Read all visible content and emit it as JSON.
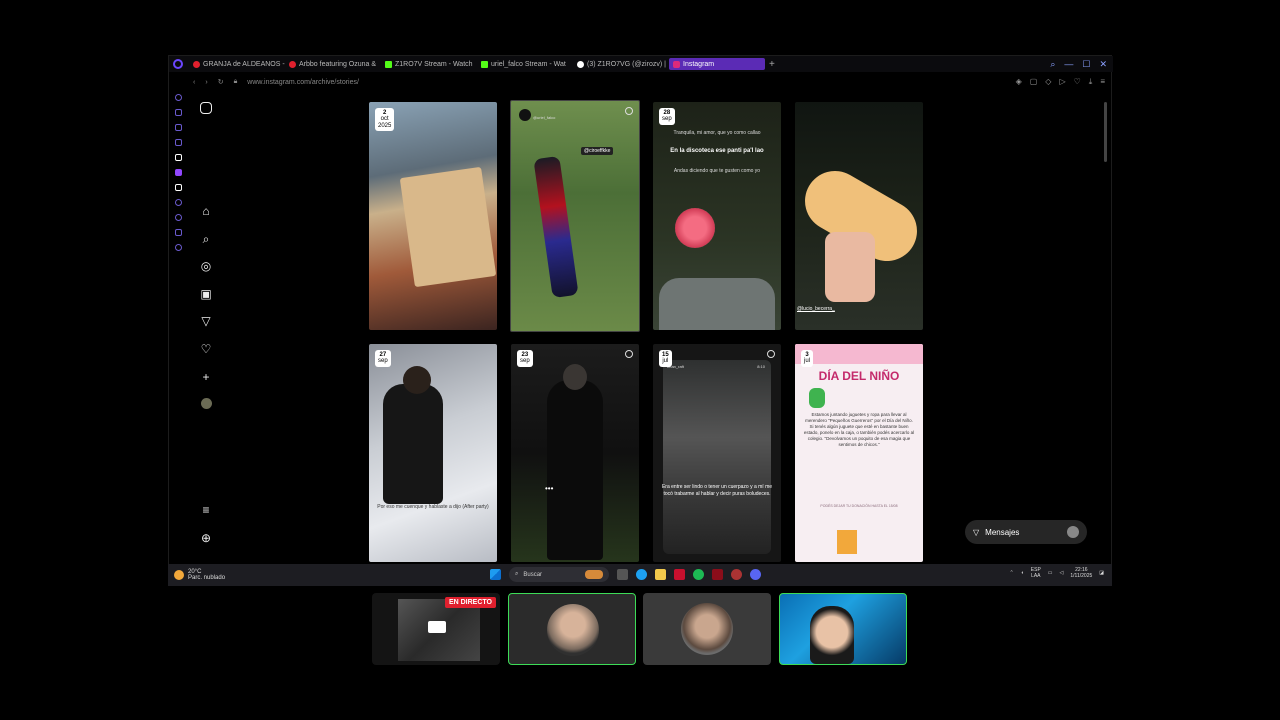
{
  "browser": {
    "tabs": [
      {
        "label": "GRANJA de ALDEANOS -",
        "color": "#e0202e"
      },
      {
        "label": "Arbbo featuring Ozuna &",
        "color": "#e0202e"
      },
      {
        "label": "Z1RO7V Stream - Watch",
        "color": "#53fc18"
      },
      {
        "label": "uriel_falco Stream - Wat",
        "color": "#53fc18"
      },
      {
        "label": "(3) Z1RO7VG (@zirozv) |",
        "color": "#ffffff"
      },
      {
        "label": "Instagram",
        "color": "#dd2a7b",
        "active": true
      }
    ],
    "url": "www.instagram.com/archive/stories/"
  },
  "stories": [
    {
      "day": "2",
      "month": "oct",
      "year": "2025"
    },
    {
      "sticker": "@ciroeffkke",
      "sticker2": "@uriel_falco"
    },
    {
      "day": "28",
      "month": "sep",
      "text1": "Tranquila, mi amor, que yo como callao",
      "text2": "En la discoteca ese panti pa'l lao",
      "text3": "Andas diciendo que te gusten como yo"
    },
    {
      "sticker": "@lucio_becerra_"
    },
    {
      "day": "27",
      "month": "sep",
      "text1": "Por eso me cuenque y hablaste a dijo (After party)"
    },
    {
      "day": "23",
      "month": "sep"
    },
    {
      "day": "15",
      "month": "jul",
      "username": "brian_raft",
      "time": "8:10",
      "text1": "Era entre ser lindo o tener un cuerpazo y a mí me tocó trabarme al hablar y decir puras boludeces."
    },
    {
      "day": "3",
      "month": "jul",
      "title": "DÍA DEL NIÑO",
      "body": "Estamos juntando juguetes y ropa para llevar al merendero \"Pequeños Guerreros\" por el Día del Niño. Si tenés algún juguete que esté en bastante buen estado, ponelo en la caja, o también podés acercarlo al colegio. \"Devolvamos un poquito de esa magia que sentimos de chicos.\"",
      "footer": "PODÉS DEJAR TU DONACIÓN HASTA EL 15/08"
    }
  ],
  "messages_label": "Mensajes",
  "taskbar": {
    "temp": "20°C",
    "weather": "Parc. nublado",
    "search": "Buscar",
    "lang1": "ESP",
    "lang2": "LAA",
    "time": "22:16",
    "date": "1/11/2025"
  },
  "live_label": "EN DIRECTO"
}
